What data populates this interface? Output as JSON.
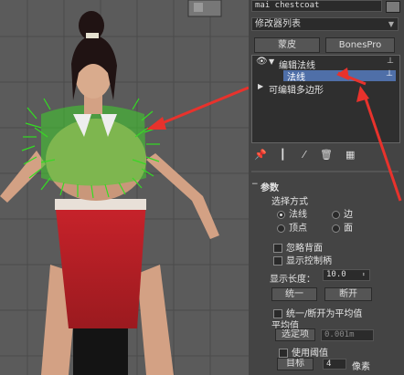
{
  "panel": {
    "object_name": "mai chestcoat",
    "modifier_list": "修改器列表",
    "buttons": {
      "skin": "蒙皮",
      "bonespro": "BonesPro"
    },
    "stack": {
      "items": [
        {
          "label": "编辑法线"
        },
        {
          "label": "法线"
        },
        {
          "label": "可编辑多边形"
        }
      ]
    },
    "rollout": {
      "title": "参数",
      "selection_mode_label": "选择方式",
      "radios": [
        {
          "label": "法线",
          "selected": true
        },
        {
          "label": "边",
          "selected": false
        },
        {
          "label": "顶点",
          "selected": false
        },
        {
          "label": "面",
          "selected": false
        }
      ],
      "checkboxes": {
        "ignore_backface": "忽略背面",
        "show_handles": "显示控制柄"
      },
      "display_length_label": "显示长度：",
      "display_length_value": "10.0",
      "unify_button": "统一",
      "break_button": "断开",
      "unify_break_average_label": "统一/断开为平均值",
      "average_label": "平均值",
      "selected_button": "选定项",
      "threshold_value": "0.001m",
      "use_threshold_label": "使用阈值",
      "target_button": "目标",
      "target_value": "4",
      "pixels_label": "像素"
    }
  },
  "colors": {
    "accent_arrow": "#e8322c",
    "highlight": "#4f6fa8",
    "normals": "#33dd22"
  }
}
